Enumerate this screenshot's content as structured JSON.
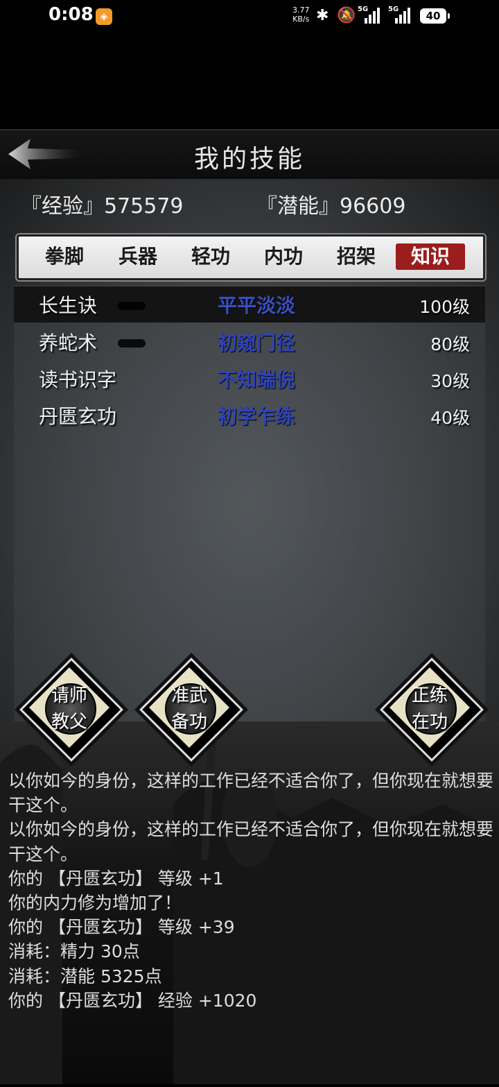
{
  "status_bar": {
    "time": "0:08",
    "net_speed": "3.77",
    "net_unit": "KB/s",
    "sim1": "5G",
    "sim2": "5G",
    "battery": "40"
  },
  "header": {
    "title": "我的技能"
  },
  "stats": {
    "exp_label": "『经验』575579",
    "pot_label": "『潜能』96609"
  },
  "tabs": [
    {
      "label": "拳脚",
      "active": false
    },
    {
      "label": "兵器",
      "active": false
    },
    {
      "label": "轻功",
      "active": false
    },
    {
      "label": "内功",
      "active": false
    },
    {
      "label": "招架",
      "active": false
    },
    {
      "label": "知识",
      "active": true
    }
  ],
  "skills": [
    {
      "name": "长生诀",
      "grade": "平平淡淡",
      "level": "100级"
    },
    {
      "name": "养蛇术",
      "grade": "初窥门径",
      "level": "80级"
    },
    {
      "name": "读书识字",
      "grade": "不知端倪",
      "level": "30级"
    },
    {
      "name": "丹匮玄功",
      "grade": "初学乍练",
      "level": "40级"
    }
  ],
  "buttons": {
    "teacher": [
      "请师",
      "教父"
    ],
    "prepare": [
      "准武",
      "备功"
    ],
    "practice": [
      "正练",
      "在功"
    ]
  },
  "log": [
    "以你如今的身份，这样的工作已经不适合你了，但你现在就想要干这个。",
    "以你如今的身份，这样的工作已经不适合你了，但你现在就想要干这个。",
    "你的 【丹匮玄功】 等级 +1",
    "你的内力修为增加了！",
    "你的 【丹匮玄功】 等级 +39",
    "消耗：精力 30点",
    "消耗：潜能 5325点",
    "你的 【丹匮玄功】 经验 +1020"
  ]
}
